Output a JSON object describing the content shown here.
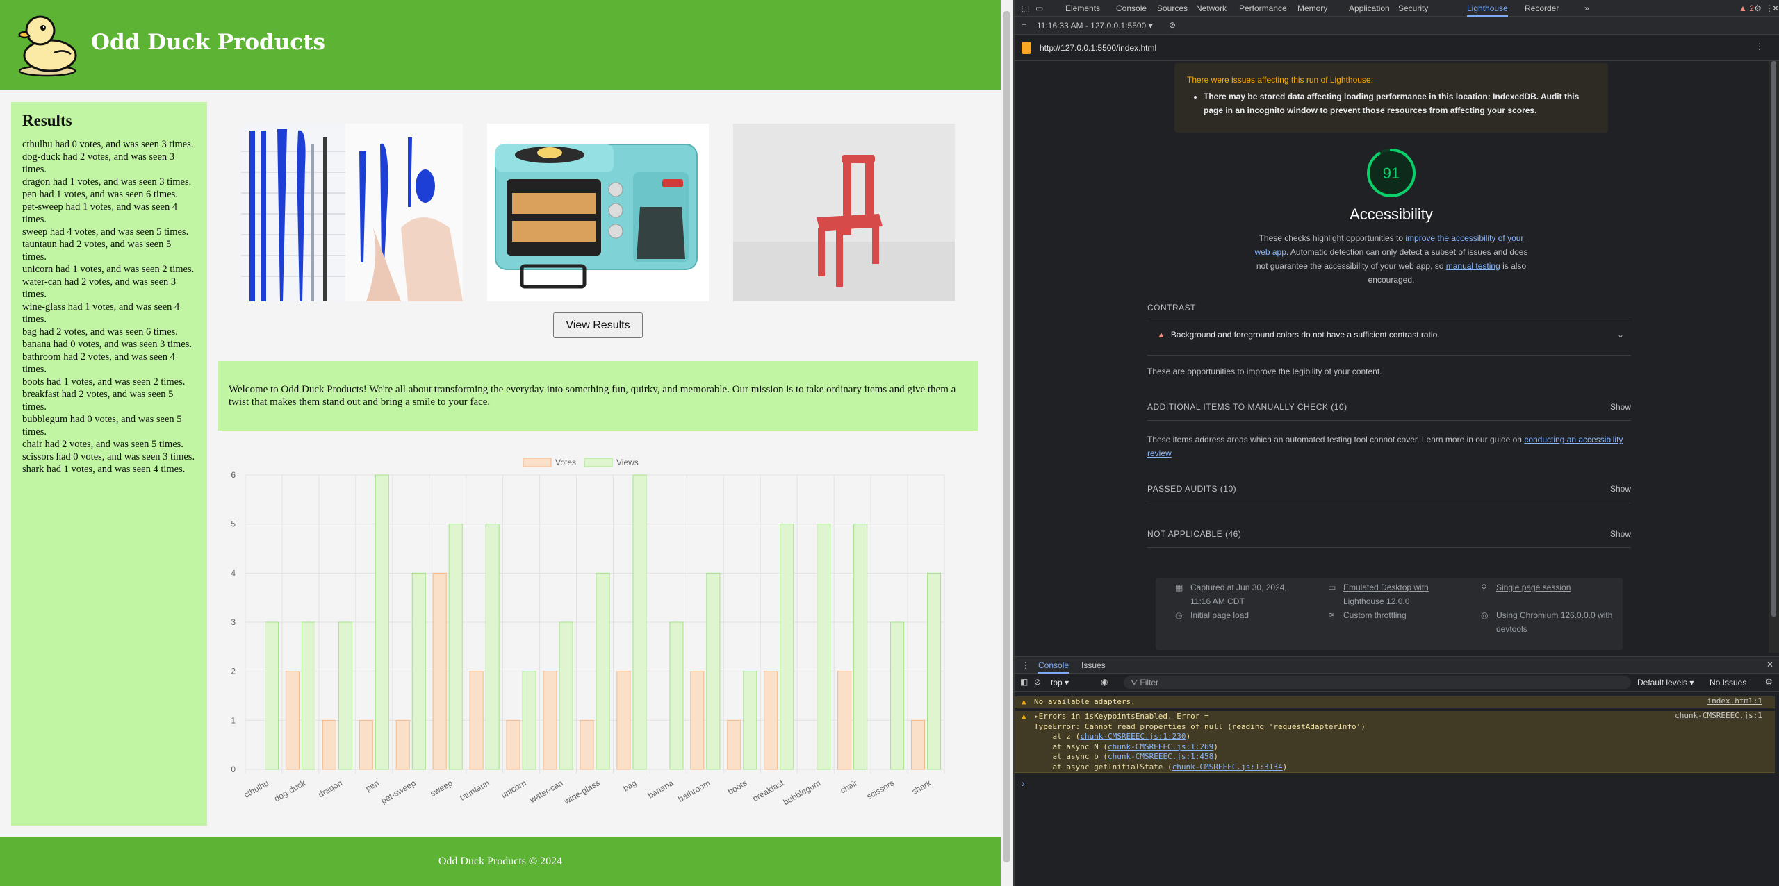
{
  "site": {
    "title": "Odd Duck Products",
    "results_title": "Results",
    "results": [
      "cthulhu had 0 votes, and was seen 3 times.",
      "dog-duck had 2 votes, and was seen 3 times.",
      "dragon had 1 votes, and was seen 3 times.",
      "pen had 1 votes, and was seen 6 times.",
      "pet-sweep had 1 votes, and was seen 4 times.",
      "sweep had 4 votes, and was seen 5 times.",
      "tauntaun had 2 votes, and was seen 5 times.",
      "unicorn had 1 votes, and was seen 2 times.",
      "water-can had 2 votes, and was seen 3 times.",
      "wine-glass had 1 votes, and was seen 4 times.",
      "bag had 2 votes, and was seen 6 times.",
      "banana had 0 votes, and was seen 3 times.",
      "bathroom had 2 votes, and was seen 4 times.",
      "boots had 1 votes, and was seen 2 times.",
      "breakfast had 2 votes, and was seen 5 times.",
      "bubblegum had 0 votes, and was seen 5 times.",
      "chair had 2 votes, and was seen 5 times.",
      "scissors had 0 votes, and was seen 3 times.",
      "shark had 1 votes, and was seen 4 times."
    ],
    "view_results_label": "View Results",
    "welcome": "Welcome to Odd Duck Products! We're all about transforming the everyday into something fun, quirky, and memorable. Our mission is to take ordinary items and give them a twist that makes them stand out and bring a smile to your face.",
    "footer": "Odd Duck Products © 2024",
    "brand_green": "#5cb334",
    "panel_green": "#c2f5a3"
  },
  "chart_data": {
    "type": "bar",
    "categories": [
      "cthulhu",
      "dog-duck",
      "dragon",
      "pen",
      "pet-sweep",
      "sweep",
      "tauntaun",
      "unicorn",
      "water-can",
      "wine-glass",
      "bag",
      "banana",
      "bathroom",
      "boots",
      "breakfast",
      "bubblegum",
      "chair",
      "scissors",
      "shark"
    ],
    "series": [
      {
        "name": "Votes",
        "values": [
          0,
          2,
          1,
          1,
          1,
          4,
          2,
          1,
          2,
          1,
          2,
          0,
          2,
          1,
          2,
          0,
          2,
          0,
          1
        ],
        "color": "#fbe0c9",
        "border": "#f5b98a"
      },
      {
        "name": "Views",
        "values": [
          3,
          3,
          3,
          6,
          4,
          5,
          5,
          2,
          3,
          4,
          6,
          3,
          4,
          2,
          5,
          5,
          5,
          3,
          4
        ],
        "color": "#dff5cf",
        "border": "#a6e38b"
      }
    ],
    "y_ticks": [
      "0",
      "1",
      "2",
      "3",
      "4",
      "5",
      "6"
    ],
    "ylim": [
      0,
      6
    ],
    "legend_position": "top",
    "grid": true
  },
  "devtools": {
    "tabs": [
      "Elements",
      "Console",
      "Sources",
      "Network",
      "Performance",
      "Memory",
      "Application",
      "Security",
      "Lighthouse",
      "Recorder"
    ],
    "active_tab": "Lighthouse",
    "more_label": "»",
    "warning_count": "2",
    "report_time": "11:16:33 AM - 127.0.0.1:5500",
    "url": "http://127.0.0.1:5500/index.html",
    "lighthouse": {
      "warning_title": "There were issues affecting this run of Lighthouse:",
      "warning_item": "There may be stored data affecting loading performance in this location: IndexedDB. Audit this page in an incognito window to prevent those resources from affecting your scores.",
      "score": "91",
      "score_value": 91,
      "score_color": "#0cce6b",
      "category": "Accessibility",
      "desc_1": "These checks highlight opportunities to ",
      "desc_link_1": "improve the accessibility of your web app",
      "desc_2": ". Automatic detection can only detect a subset of issues and does not guarantee the accessibility of your web app, so ",
      "desc_link_2": "manual testing",
      "desc_3": " is also encouraged.",
      "contrast_heading": "CONTRAST",
      "contrast_audit": "Background and foreground colors do not have a sufficient contrast ratio.",
      "contrast_note": "These are opportunities to improve the legibility of your content.",
      "manual_heading": "ADDITIONAL ITEMS TO MANUALLY CHECK (10)",
      "manual_note_1": "These items address areas which an automated testing tool cannot cover. Learn more in our guide on ",
      "manual_note_link": "conducting an accessibility review",
      "passed_heading": "PASSED AUDITS (10)",
      "na_heading": "NOT APPLICABLE (46)",
      "show_label": "Show",
      "meta_captured": "Captured at Jun 30, 2024, 11:16 AM CDT",
      "meta_load": "Initial page load",
      "meta_device": "Emulated Desktop with Lighthouse 12.0.0",
      "meta_throttle": "Custom throttling",
      "meta_session": "Single page session",
      "meta_browser": "Using Chromium 126.0.0.0 with devtools"
    },
    "console": {
      "tabs": [
        "Console",
        "Issues"
      ],
      "context": "top",
      "filter_placeholder": "Filter",
      "levels": "Default levels",
      "issues": "No Issues",
      "msg1": "No available adapters.",
      "msg1_src": "index.html:1",
      "msg2_line1": "Errors in isKeypointsEnabled. Error =",
      "msg2_line2": "TypeError: Cannot read properties of null (reading 'requestAdapterInfo')",
      "msg2_src": "chunk-CMSREEEC.js:1",
      "trace": [
        {
          "pre": "    at z (",
          "link": "chunk-CMSREEEC.js:1:230",
          "post": ")"
        },
        {
          "pre": "    at async N (",
          "link": "chunk-CMSREEEC.js:1:269",
          "post": ")"
        },
        {
          "pre": "    at async b (",
          "link": "chunk-CMSREEEC.js:1:458",
          "post": ")"
        },
        {
          "pre": "    at async getInitialState (",
          "link": "chunk-CMSREEEC.js:1:3134",
          "post": ")"
        }
      ],
      "prompt": "›"
    }
  }
}
